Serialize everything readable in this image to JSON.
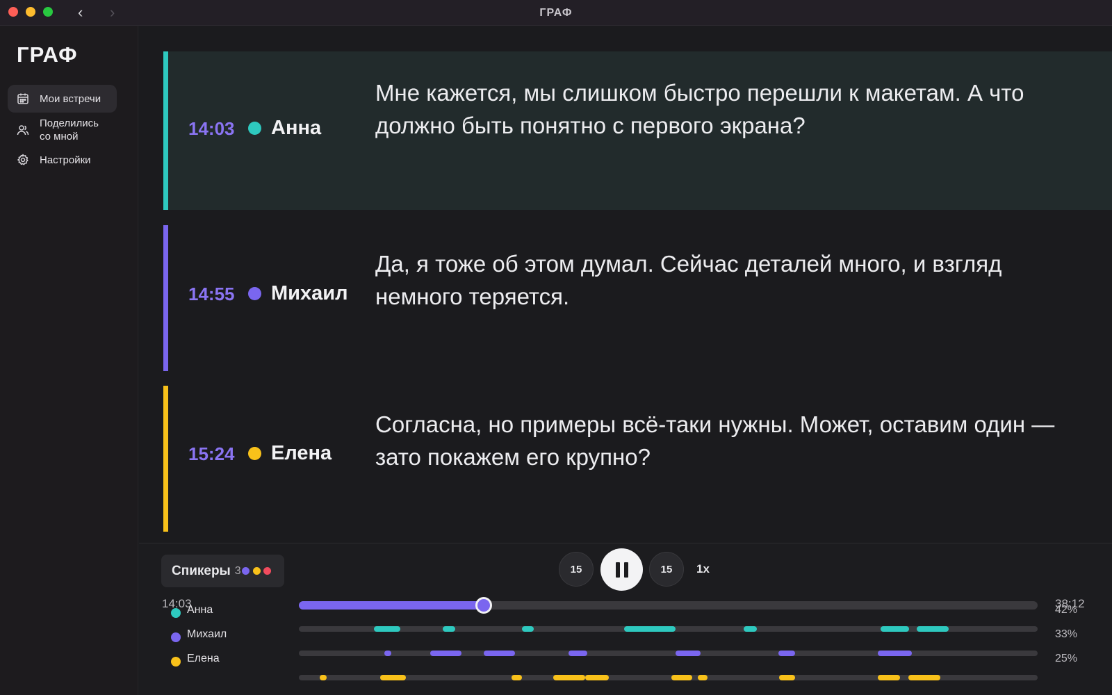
{
  "window": {
    "title": "ГРАФ",
    "colors": {
      "accent": "#7a66ef",
      "anna": "#2ec9bf",
      "mikhail": "#7a66ef",
      "elena": "#f8c11a",
      "extra": "#f14b5e"
    }
  },
  "sidebar": {
    "logo": "ГРАФ",
    "items": [
      {
        "label": "Мои встречи",
        "icon": "calendar-icon",
        "active": true
      },
      {
        "label": "Поделились со мной",
        "icon": "users-icon",
        "active": false
      },
      {
        "label": "Настройки",
        "icon": "gear-icon",
        "active": false
      }
    ]
  },
  "transcript": [
    {
      "time": "14:03",
      "speaker": "Анна",
      "color": "#2ec9bf",
      "text": "Мне кажется, мы слишком быстро перешли к макетам. А что должно быть понятно с первого экрана?",
      "highlighted": true
    },
    {
      "time": "14:55",
      "speaker": "Михаил",
      "color": "#7a66ef",
      "text": "Да, я тоже об этом думал. Сейчас деталей много, и взгляд немного теряется.",
      "highlighted": false
    },
    {
      "time": "15:24",
      "speaker": "Елена",
      "color": "#f8c11a",
      "text": "Согласна, но примеры всё-таки нужны. Может, оставим один — зато покажем его крупно?",
      "highlighted": false
    }
  ],
  "player": {
    "speakers_label": "Спикеры",
    "speakers_count": "3",
    "skip_back": "15",
    "skip_forward": "15",
    "speed": "1x",
    "current_time": "14:03",
    "total_time": "38:12",
    "progress_fraction": 0.25,
    "speakers": [
      {
        "name": "Анна",
        "percent": "42%",
        "color": "#2ec9bf",
        "segments": [
          [
            0.102,
            0.137
          ],
          [
            0.195,
            0.212
          ],
          [
            0.302,
            0.318
          ],
          [
            0.44,
            0.51
          ],
          [
            0.602,
            0.62
          ],
          [
            0.787,
            0.826
          ],
          [
            0.836,
            0.88
          ]
        ]
      },
      {
        "name": "Михаил",
        "percent": "33%",
        "color": "#7a66ef",
        "segments": [
          [
            0.116,
            0.125
          ],
          [
            0.178,
            0.22
          ],
          [
            0.25,
            0.293
          ],
          [
            0.365,
            0.39
          ],
          [
            0.51,
            0.544
          ],
          [
            0.649,
            0.672
          ],
          [
            0.784,
            0.83
          ]
        ]
      },
      {
        "name": "Елена",
        "percent": "25%",
        "color": "#f8c11a",
        "segments": [
          [
            0.028,
            0.038
          ],
          [
            0.11,
            0.145
          ],
          [
            0.288,
            0.302
          ],
          [
            0.344,
            0.388
          ],
          [
            0.388,
            0.42
          ],
          [
            0.504,
            0.532
          ],
          [
            0.54,
            0.553
          ],
          [
            0.65,
            0.672
          ],
          [
            0.784,
            0.814
          ],
          [
            0.825,
            0.868
          ]
        ]
      }
    ]
  }
}
